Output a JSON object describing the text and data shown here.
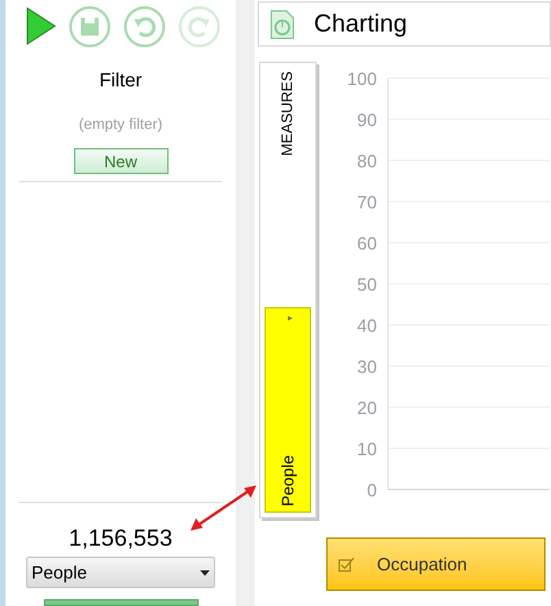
{
  "left_panel": {
    "filter_title": "Filter",
    "filter_status": "(empty filter)",
    "new_button": "New",
    "count": "1,156,553",
    "dropdown": {
      "value": "People"
    }
  },
  "window": {
    "title": "Charting"
  },
  "measures": {
    "label": "MEASURES",
    "item": "People",
    "arrow": "▸"
  },
  "chart": {
    "y_axis_labels": [
      "100",
      "90",
      "80",
      "70",
      "60",
      "50",
      "40",
      "30",
      "20",
      "10",
      "0"
    ]
  },
  "axis_button": {
    "label": "Occupation"
  }
}
